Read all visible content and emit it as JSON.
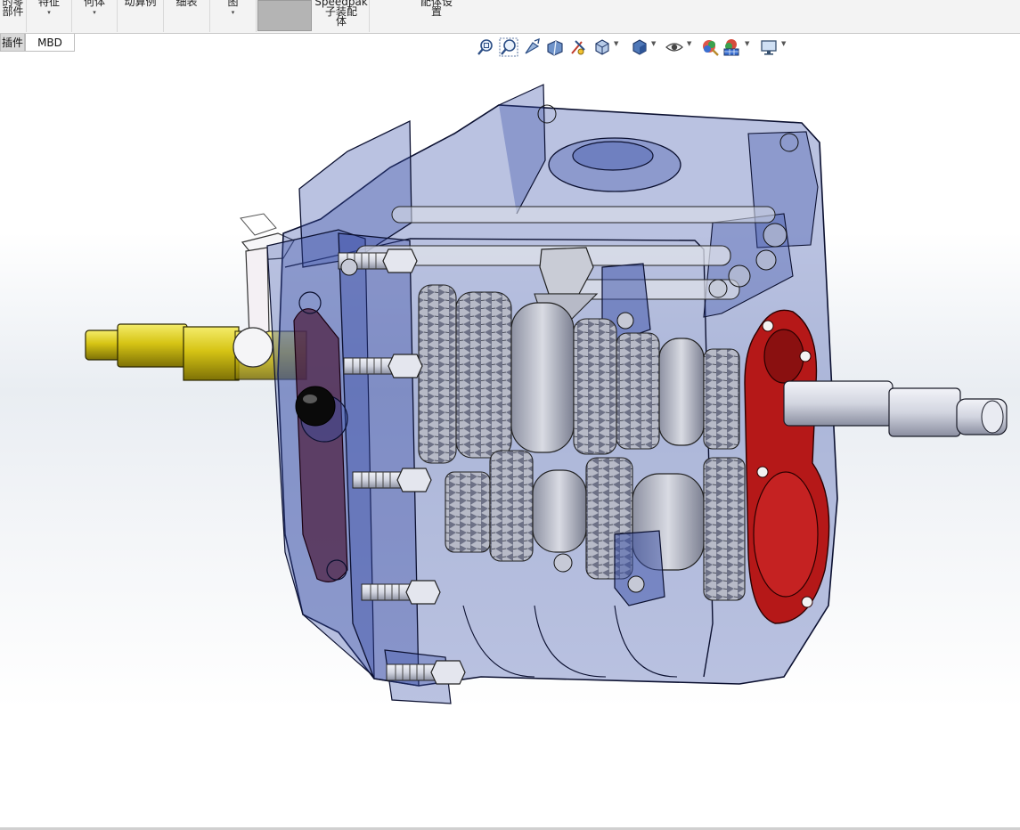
{
  "ribbon": {
    "items": [
      {
        "label": "的零\n部件",
        "arrow": ""
      },
      {
        "label": "特征",
        "arrow": "▾"
      },
      {
        "label": "何体",
        "arrow": "▾"
      },
      {
        "label": "动算例",
        "arrow": ""
      },
      {
        "label": "细表",
        "arrow": ""
      },
      {
        "label": "图",
        "arrow": "▾"
      },
      {
        "label": "",
        "arrow": ""
      },
      {
        "label": "Speedpak\n子装配\n体",
        "arrow": ""
      },
      {
        "label": "配体设\n置",
        "arrow": ""
      }
    ]
  },
  "tabs": [
    {
      "label": "插件"
    },
    {
      "label": "MBD"
    }
  ],
  "heads_up_toolbar": {
    "icons": [
      "zoom-to-fit",
      "zoom-to-area",
      "previous-view",
      "section-view",
      "dynamic-annotation-views",
      "view-orientation",
      "display-style",
      "hide-show-items",
      "edit-appearance",
      "apply-scene",
      "view-settings"
    ]
  },
  "colors": {
    "housing_fill": "#3a4fa8",
    "housing_stroke": "#0b1030",
    "gear_fill": "#c9ccd6",
    "shaft_yellow": "#d6c414",
    "flange_red": "#b51818",
    "steel": "#dfe2ea"
  }
}
